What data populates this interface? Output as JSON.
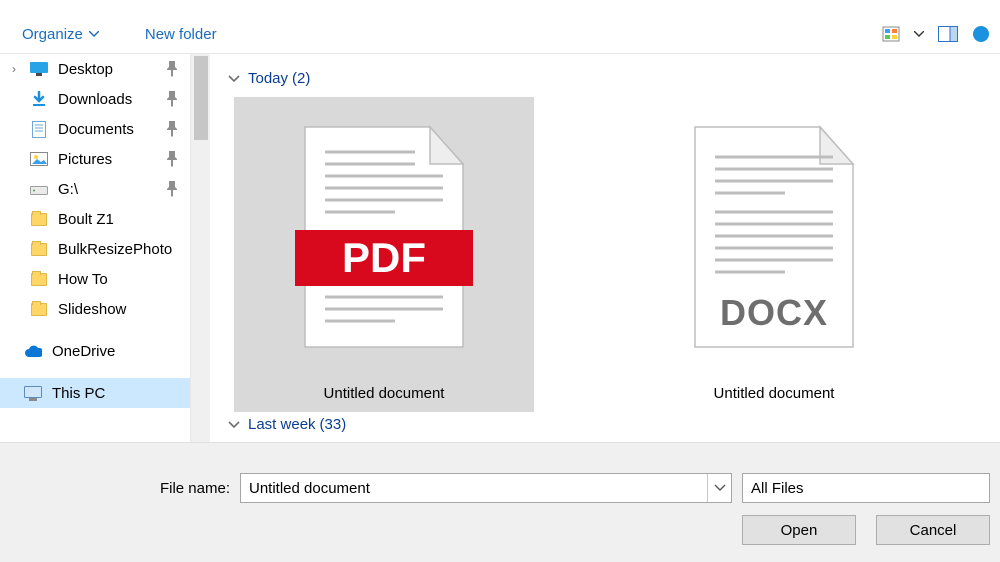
{
  "toolbar": {
    "organize": "Organize",
    "new_folder": "New folder"
  },
  "sidebar": {
    "items": [
      {
        "label": "Desktop",
        "icon": "desktop",
        "pinned": true,
        "expand": true
      },
      {
        "label": "Downloads",
        "icon": "downloads",
        "pinned": true
      },
      {
        "label": "Documents",
        "icon": "documents",
        "pinned": true
      },
      {
        "label": "Pictures",
        "icon": "pictures",
        "pinned": true
      },
      {
        "label": "G:\\",
        "icon": "drive",
        "pinned": true
      },
      {
        "label": "Boult Z1",
        "icon": "folder"
      },
      {
        "label": "BulkResizePhoto",
        "icon": "folder"
      },
      {
        "label": "How To",
        "icon": "folder"
      },
      {
        "label": "Slideshow",
        "icon": "folder"
      }
    ],
    "onedrive": "OneDrive",
    "this_pc": "This PC"
  },
  "groups": [
    {
      "name": "Today",
      "count": "(2)"
    },
    {
      "name": "Last week",
      "count": "(33)"
    }
  ],
  "files": [
    {
      "name": "Untitled document",
      "type": "pdf",
      "selected": true
    },
    {
      "name": "Untitled document",
      "type": "docx"
    }
  ],
  "filename_label": "File name:",
  "filename_value": "Untitled document",
  "filter_value": "All Files",
  "buttons": {
    "open": "Open",
    "cancel": "Cancel"
  },
  "icons": {
    "pdf_label": "PDF",
    "docx_label": "DOCX"
  }
}
